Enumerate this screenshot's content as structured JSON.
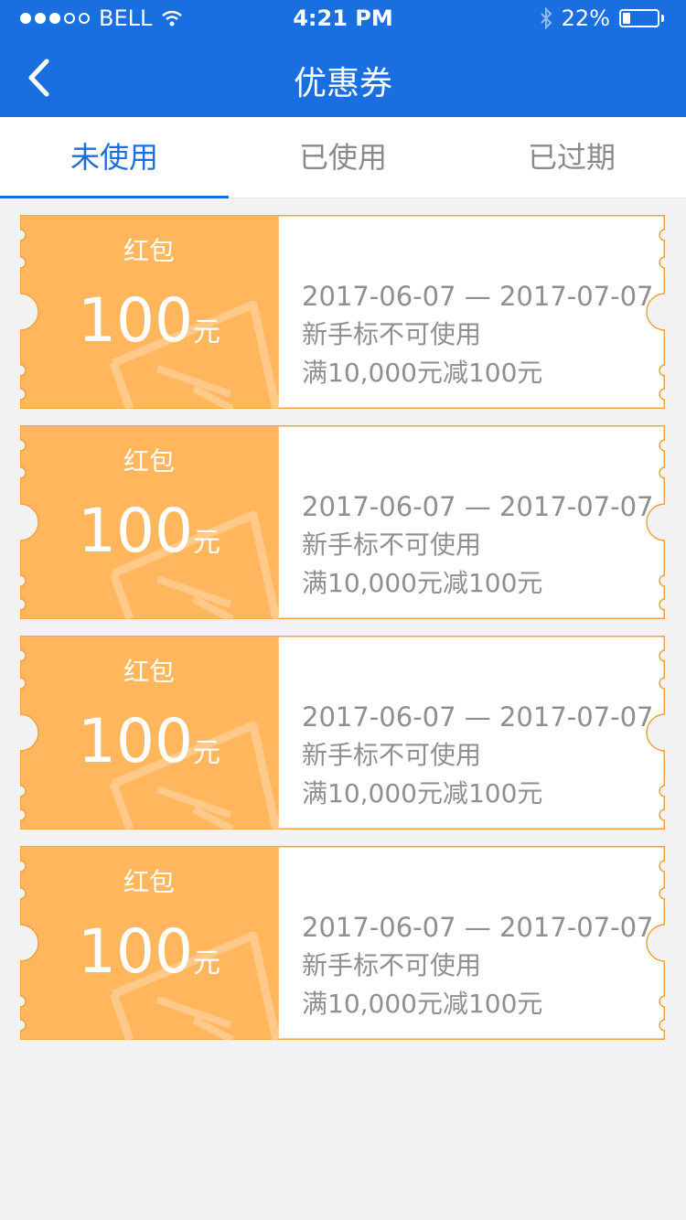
{
  "status_bar": {
    "carrier": "BELL",
    "time": "4:21 PM",
    "battery_percent_text": "22%",
    "battery_level": 0.22
  },
  "nav": {
    "title": "优惠券",
    "back_icon": "chevron-left-icon"
  },
  "tabs": [
    {
      "label": "未使用",
      "active": true
    },
    {
      "label": "已使用",
      "active": false
    },
    {
      "label": "已过期",
      "active": false
    }
  ],
  "coupons": [
    {
      "type": "红包",
      "amount": "100",
      "unit": "元",
      "date_range": "2017-06-07 — 2017-07-07",
      "restriction": "新手标不可使用",
      "condition": "满10,000元减100元"
    },
    {
      "type": "红包",
      "amount": "100",
      "unit": "元",
      "date_range": "2017-06-07 — 2017-07-07",
      "restriction": "新手标不可使用",
      "condition": "满10,000元减100元"
    },
    {
      "type": "红包",
      "amount": "100",
      "unit": "元",
      "date_range": "2017-06-07 — 2017-07-07",
      "restriction": "新手标不可使用",
      "condition": "满10,000元减100元"
    },
    {
      "type": "红包",
      "amount": "100",
      "unit": "元",
      "date_range": "2017-06-07 — 2017-07-07",
      "restriction": "新手标不可使用",
      "condition": "满10,000元减100元"
    }
  ],
  "colors": {
    "header": "#1a6fe0",
    "coupon_orange": "#ffb65c",
    "coupon_border": "#f2a23a"
  }
}
